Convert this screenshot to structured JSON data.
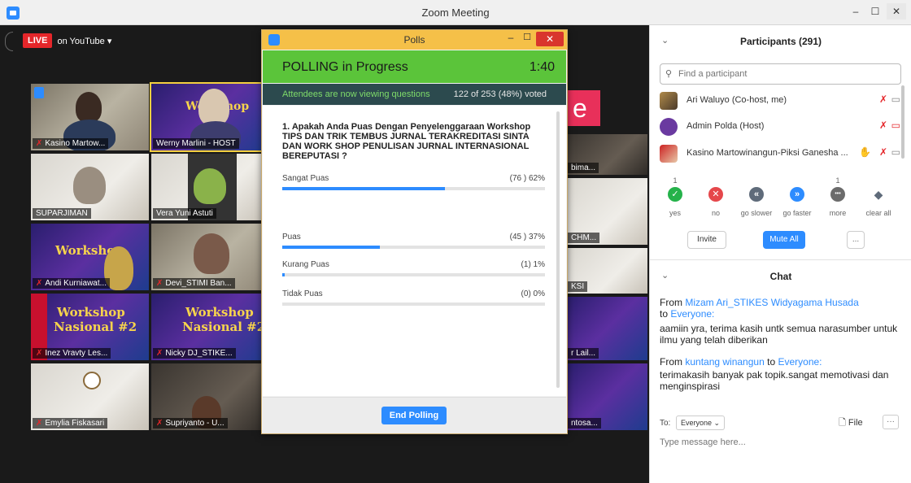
{
  "window": {
    "title": "Zoom Meeting",
    "minimize": "–",
    "maximize": "☐",
    "close": "✕"
  },
  "live": {
    "badge": "LIVE",
    "platform": "on YouTube ▾"
  },
  "tiles": [
    {
      "name": "Kasino Martow..."
    },
    {
      "name": "Werny Marlini - HOST"
    },
    {
      "name": "bima..."
    },
    {
      "name": "SUPARJIMAN"
    },
    {
      "name": "Vera Yuni Astuti"
    },
    {
      "name": "CHM..."
    },
    {
      "name": "Andi Kurniawat..."
    },
    {
      "name": "Devi_STIMI Ban..."
    },
    {
      "name": "KSI"
    },
    {
      "name": "Inez Vravty Les..."
    },
    {
      "name": "Nicky DJ_STIKE..."
    },
    {
      "name": "r Lail..."
    },
    {
      "name": "Emylia Fiskasari"
    },
    {
      "name": "Supriyanto - U..."
    },
    {
      "name": "ntosa..."
    }
  ],
  "flyer": {
    "line1": "Workshop",
    "line2": "Nasional #2"
  },
  "polls": {
    "window_title": "Polls",
    "status": "POLLING  in Progress",
    "timer": "1:40",
    "viewing": "Attendees are now viewing questions",
    "voted": "122 of 253 (48%) voted",
    "question": "1. Apakah Anda Puas Dengan Penyelenggaraan Workshop TIPS DAN TRIK TEMBUS JURNAL TERAKREDITASI SINTA DAN WORK SHOP PENULISAN JURNAL INTERNASIONAL BEREPUTASI ?",
    "answers": [
      {
        "label": "Sangat Puas",
        "result": "(76 ) 62%",
        "pct": 62
      },
      {
        "label": "Puas",
        "result": "(45 ) 37%",
        "pct": 37
      },
      {
        "label": "Kurang Puas",
        "result": "(1) 1%",
        "pct": 1
      },
      {
        "label": "Tidak Puas",
        "result": "(0) 0%",
        "pct": 0
      }
    ],
    "end_button": "End Polling"
  },
  "participants": {
    "header": "Participants (291)",
    "search_placeholder": "Find a participant",
    "list": [
      {
        "name": "Ari Waluyo (Co-host, me)"
      },
      {
        "name": "Admin Polda (Host)"
      },
      {
        "name": "Kasino Martowinangun-Piksi Ganesha ..."
      }
    ],
    "feedback": [
      {
        "label": "yes",
        "count": "1",
        "color": "#25b24a",
        "glyph": "✓"
      },
      {
        "label": "no",
        "count": "",
        "color": "#e5474b",
        "glyph": "✕"
      },
      {
        "label": "go slower",
        "count": "",
        "color": "#5f6b7a",
        "glyph": "«"
      },
      {
        "label": "go faster",
        "count": "",
        "color": "#2d8cff",
        "glyph": "»"
      },
      {
        "label": "more",
        "count": "1",
        "color": "#6b6b6b",
        "glyph": "•••"
      },
      {
        "label": "clear all",
        "count": "",
        "color": "#5f6b7a",
        "glyph": "◆"
      }
    ],
    "invite": "Invite",
    "mute_all": "Mute All",
    "more": "..."
  },
  "chat": {
    "header": "Chat",
    "messages": [
      {
        "from_prefix": "From",
        "from": "Mizam Ari_STIKES Widyagama Husada",
        "to_prefix": "to",
        "to": "Everyone:",
        "text": "aamiin yra, terima kasih untk semua narasumber untuk ilmu yang telah diberikan"
      },
      {
        "from_prefix": "From",
        "from": "kuntang winangun",
        "to_prefix": "to",
        "to": "Everyone:",
        "text": "terimakasih banyak pak topik.sangat memotivasi dan menginspirasi"
      }
    ],
    "to_label": "To:",
    "to_value": "Everyone ⌄",
    "file": "File",
    "more": "···",
    "input_placeholder": "Type message here..."
  }
}
